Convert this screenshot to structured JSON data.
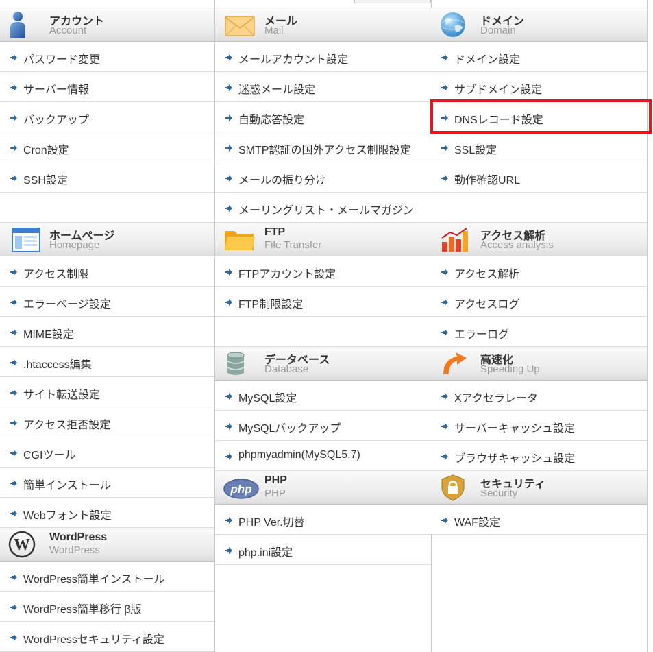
{
  "highlight_color": "#e8141e",
  "columns": [
    {
      "sections": [
        {
          "id": "account",
          "icon": "person-icon",
          "title": "アカウント",
          "subtitle": "Account",
          "items": [
            {
              "label": "パスワード変更"
            },
            {
              "label": "サーバー情報"
            },
            {
              "label": "バックアップ"
            },
            {
              "label": "Cron設定"
            },
            {
              "label": "SSH設定"
            },
            {
              "label": ""
            }
          ]
        },
        {
          "id": "homepage",
          "icon": "browser-window-icon",
          "title": "ホームページ",
          "subtitle": "Homepage",
          "items": [
            {
              "label": "アクセス制限"
            },
            {
              "label": "エラーページ設定"
            },
            {
              "label": "MIME設定"
            },
            {
              "label": ".htaccess編集"
            },
            {
              "label": "サイト転送設定"
            },
            {
              "label": "アクセス拒否設定"
            },
            {
              "label": "CGIツール"
            },
            {
              "label": "簡単インストール"
            },
            {
              "label": "Webフォント設定"
            }
          ]
        },
        {
          "id": "wordpress",
          "icon": "wordpress-logo-icon",
          "title": "WordPress",
          "subtitle": "WordPress",
          "items": [
            {
              "label": "WordPress簡単インストール"
            },
            {
              "label": "WordPress簡単移行 β版"
            },
            {
              "label": "WordPressセキュリティ設定"
            }
          ]
        }
      ]
    },
    {
      "sections": [
        {
          "id": "mail",
          "icon": "envelope-icon",
          "title": "メール",
          "subtitle": "Mail",
          "items": [
            {
              "label": "メールアカウント設定"
            },
            {
              "label": "迷惑メール設定"
            },
            {
              "label": "自動応答設定"
            },
            {
              "label": "SMTP認証の国外アクセス制限設定"
            },
            {
              "label": "メールの振り分け"
            },
            {
              "label": "メーリングリスト・メールマガジン"
            }
          ]
        },
        {
          "id": "ftp",
          "icon": "folder-icon",
          "title": "FTP",
          "subtitle": "File Transfer",
          "items": [
            {
              "label": "FTPアカウント設定"
            },
            {
              "label": "FTP制限設定"
            },
            {
              "label": ""
            }
          ]
        },
        {
          "id": "database",
          "icon": "database-icon",
          "title": "データベース",
          "subtitle": "Database",
          "items": [
            {
              "label": "MySQL設定"
            },
            {
              "label": "MySQLバックアップ"
            },
            {
              "label": "phpmyadmin(MySQL5.7)"
            }
          ]
        },
        {
          "id": "php",
          "icon": "php-logo-icon",
          "title": "PHP",
          "subtitle": "PHP",
          "items": [
            {
              "label": "PHP Ver.切替"
            },
            {
              "label": "php.ini設定"
            }
          ]
        }
      ]
    },
    {
      "sections": [
        {
          "id": "domain",
          "icon": "globe-icon",
          "title": "ドメイン",
          "subtitle": "Domain",
          "items": [
            {
              "label": "ドメイン設定"
            },
            {
              "label": "サブドメイン設定"
            },
            {
              "label": "DNSレコード設定",
              "highlighted": true
            },
            {
              "label": "SSL設定"
            },
            {
              "label": "動作確認URL"
            },
            {
              "label": ""
            }
          ]
        },
        {
          "id": "access-analysis",
          "icon": "bar-chart-icon",
          "title": "アクセス解析",
          "subtitle": "Access analysis",
          "items": [
            {
              "label": "アクセス解析"
            },
            {
              "label": "アクセスログ"
            },
            {
              "label": "エラーログ"
            }
          ]
        },
        {
          "id": "speeding-up",
          "icon": "speed-arrow-icon",
          "title": "高速化",
          "subtitle": "Speeding Up",
          "items": [
            {
              "label": "Xアクセラレータ"
            },
            {
              "label": "サーバーキャッシュ設定"
            },
            {
              "label": "ブラウザキャッシュ設定"
            }
          ]
        },
        {
          "id": "security",
          "icon": "shield-lock-icon",
          "title": "セキュリティ",
          "subtitle": "Security",
          "items": [
            {
              "label": "WAF設定"
            }
          ]
        }
      ]
    }
  ]
}
